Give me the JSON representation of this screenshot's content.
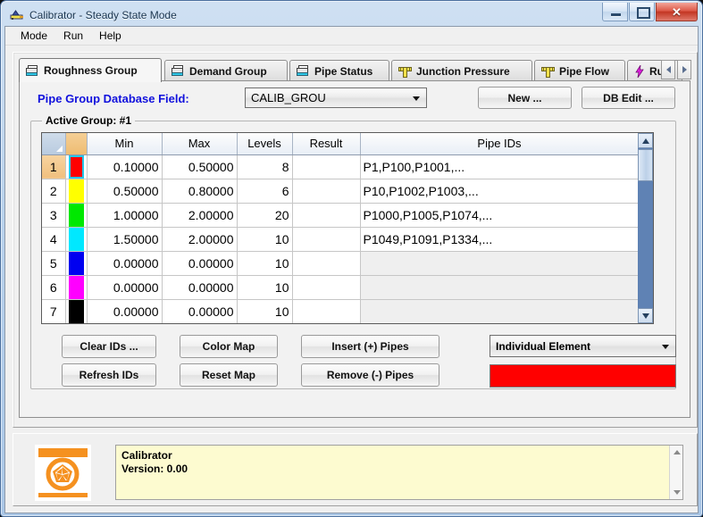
{
  "window": {
    "title": "Calibrator - Steady State Mode",
    "icon": "calibrator-app-icon",
    "minimize_label": "Minimize",
    "maximize_label": "Maximize",
    "close_label": "✕"
  },
  "menubar": {
    "items": [
      {
        "label": "Mode"
      },
      {
        "label": "Run"
      },
      {
        "label": "Help"
      }
    ]
  },
  "tabs": [
    {
      "label": "Roughness Group",
      "icon": "stack-icon",
      "active": true
    },
    {
      "label": "Demand Group",
      "icon": "stack-icon",
      "active": false
    },
    {
      "label": "Pipe Status",
      "icon": "stack-icon",
      "active": false
    },
    {
      "label": "Junction Pressure",
      "icon": "ruler-icon",
      "active": false
    },
    {
      "label": "Pipe Flow",
      "icon": "ruler-icon",
      "active": false
    },
    {
      "label": "Run",
      "icon": "bolt-icon",
      "active": false
    }
  ],
  "tab_nav": {
    "prev": "◄",
    "next": "►"
  },
  "toolbar": {
    "db_field_label": "Pipe Group Database Field:",
    "db_field_value": "CALIB_GROU",
    "new_label": "New ...",
    "db_edit_label": "DB Edit ..."
  },
  "group": {
    "title": "Active Group: #1"
  },
  "grid": {
    "columns": [
      "",
      "",
      "Min",
      "Max",
      "Levels",
      "Result",
      "Pipe IDs"
    ],
    "rows": [
      {
        "num": "1",
        "color": "#ff0000",
        "min": "0.10000",
        "max": "0.50000",
        "levels": "8",
        "result": "",
        "ids": "P1,P100,P1001,...",
        "selected": true
      },
      {
        "num": "2",
        "color": "#ffff00",
        "min": "0.50000",
        "max": "0.80000",
        "levels": "6",
        "result": "",
        "ids": "P10,P1002,P1003,...",
        "selected": false
      },
      {
        "num": "3",
        "color": "#00e800",
        "min": "1.00000",
        "max": "2.00000",
        "levels": "20",
        "result": "",
        "ids": "P1000,P1005,P1074,...",
        "selected": false
      },
      {
        "num": "4",
        "color": "#00e8ff",
        "min": "1.50000",
        "max": "2.00000",
        "levels": "10",
        "result": "",
        "ids": "P1049,P1091,P1334,...",
        "selected": false
      },
      {
        "num": "5",
        "color": "#0000f0",
        "min": "0.00000",
        "max": "0.00000",
        "levels": "10",
        "result": "",
        "ids": "",
        "selected": false
      },
      {
        "num": "6",
        "color": "#ff00ff",
        "min": "0.00000",
        "max": "0.00000",
        "levels": "10",
        "result": "",
        "ids": "",
        "selected": false
      },
      {
        "num": "7",
        "color": "#000000",
        "min": "0.00000",
        "max": "0.00000",
        "levels": "10",
        "result": "",
        "ids": "",
        "selected": false
      }
    ]
  },
  "actions": {
    "clear_ids": "Clear IDs ...",
    "refresh_ids": "Refresh IDs",
    "color_map": "Color Map",
    "reset_map": "Reset Map",
    "insert_pipes": "Insert (+) Pipes",
    "remove_pipes": "Remove (-) Pipes",
    "element_mode": "Individual Element",
    "color_preview": "#ff0000"
  },
  "status": {
    "app_name": "Calibrator",
    "version_line": "Version: 0.00",
    "text": "Calibrator\nVersion: 0.00"
  }
}
